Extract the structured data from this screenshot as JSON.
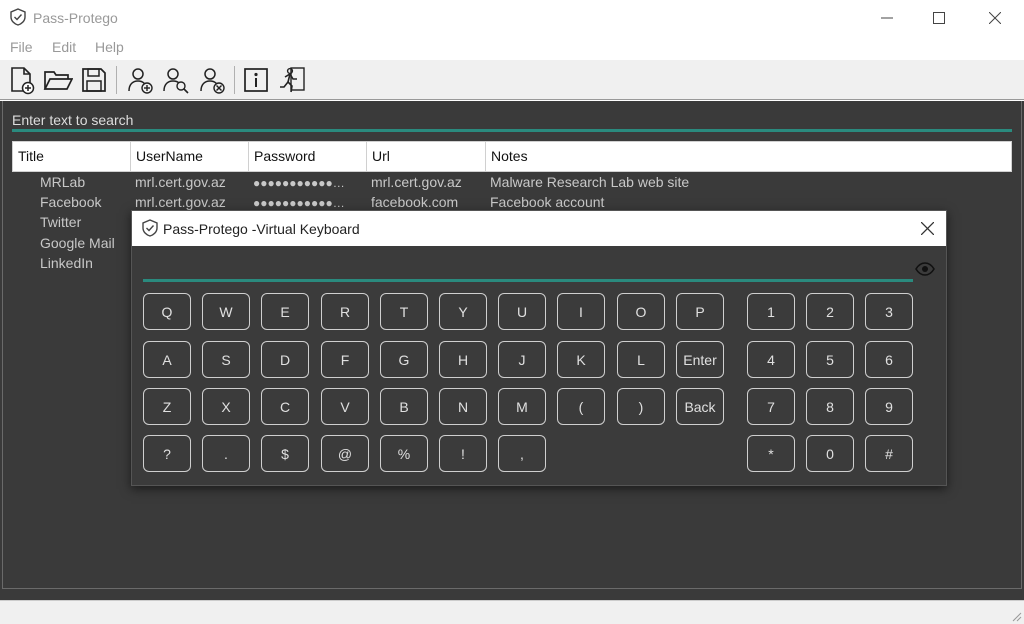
{
  "window": {
    "title": "Pass-Protego"
  },
  "menu": {
    "items": [
      {
        "label": "File"
      },
      {
        "label": "Edit"
      },
      {
        "label": "Help"
      }
    ]
  },
  "toolbar": {
    "buttons": [
      {
        "name": "new-file",
        "icon": "new-file-icon"
      },
      {
        "name": "open-folder",
        "icon": "open-folder-icon"
      },
      {
        "name": "save",
        "icon": "save-icon"
      },
      {
        "name": "add-user",
        "icon": "add-user-icon"
      },
      {
        "name": "search-user",
        "icon": "search-user-icon"
      },
      {
        "name": "delete-user",
        "icon": "delete-user-icon"
      },
      {
        "name": "info",
        "icon": "info-icon"
      },
      {
        "name": "exit",
        "icon": "running-man-icon"
      }
    ]
  },
  "search": {
    "placeholder": "Enter text to search"
  },
  "grid": {
    "columns": [
      "Title",
      "UserName",
      "Password",
      "Url",
      "Notes"
    ],
    "rows": [
      {
        "title": "MRLab",
        "username": "mrl.cert.gov.az",
        "password": "●●●●●●●●●●●…",
        "url": "mrl.cert.gov.az",
        "notes": "Malware Research Lab web site"
      },
      {
        "title": "Facebook",
        "username": "mrl.cert.gov.az",
        "password": "●●●●●●●●●●●…",
        "url": "facebook.com",
        "notes": "Facebook account"
      },
      {
        "title": "Twitter",
        "username": "",
        "password": "",
        "url": "",
        "notes": ""
      },
      {
        "title": "Google Mail",
        "username": "",
        "password": "",
        "url": "",
        "notes": ""
      },
      {
        "title": "LinkedIn",
        "username": "",
        "password": "",
        "url": "",
        "notes": ""
      }
    ]
  },
  "vk": {
    "title": "Pass-Protego -Virtual Keyboard",
    "input_value": "",
    "letter_rows": [
      [
        "Q",
        "W",
        "E",
        "R",
        "T",
        "Y",
        "U",
        "I",
        "O",
        "P"
      ],
      [
        "A",
        "S",
        "D",
        "F",
        "G",
        "H",
        "J",
        "K",
        "L",
        "Enter"
      ],
      [
        "Z",
        "X",
        "C",
        "V",
        "B",
        "N",
        "M",
        "(",
        ")",
        "Back"
      ],
      [
        "?",
        ".",
        "$",
        "@",
        "%",
        "!",
        ","
      ]
    ],
    "num_rows": [
      [
        "1",
        "2",
        "3"
      ],
      [
        "4",
        "5",
        "6"
      ],
      [
        "7",
        "8",
        "9"
      ],
      [
        "*",
        "0",
        "#"
      ]
    ]
  },
  "colors": {
    "accent": "#2a8a7e",
    "background": "#3a3a3a"
  }
}
